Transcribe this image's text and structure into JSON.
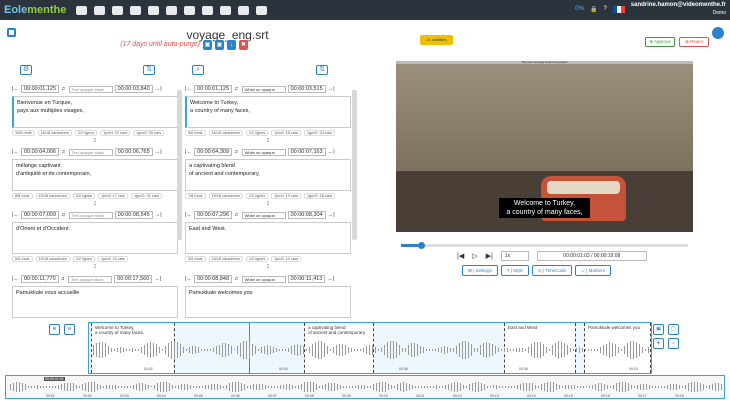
{
  "app": {
    "logo_a": "Eole",
    "logo_b": "menthe",
    "credits": "0%",
    "user_email": "sandrine.hamon@videomenthe.fr",
    "user_role": "Demo"
  },
  "file": {
    "title": "voyage_eng.srt",
    "autopurge": "(17 days until auto-purge)",
    "badge": "21 subtitles"
  },
  "actions": {
    "approve": "⊕ Approve",
    "reject": "⊗ Reject"
  },
  "source": {
    "placeholder_style": "Text opaque black",
    "subs": [
      {
        "start": "00:00:01,125",
        "end": "00:00:03,840",
        "text": "Bienvenue en Turquie,\npays aux multiples visages,",
        "stats": [
          "10/6 mots",
          "16/18 caracteres",
          "2/2 lignes",
          "1pm/l: 22 cars",
          "1gm/2: 25 cars"
        ]
      },
      {
        "start": "00:00:04,006",
        "end": "00:00:06,765",
        "text": "mélange captivant\nd'antiquité et de contemporain,",
        "stats": [
          "8/8 mots",
          "15/18 caracteres",
          "2/2 lignes",
          "1pm/l: 17 cars",
          "1gm/2: 31 cars"
        ]
      },
      {
        "start": "00:00:07,009",
        "end": "00:00:08,545",
        "text": "d'Orient et d'Occident.",
        "stats": [
          "5/6 mots",
          "16/18 caracteres",
          "1/2 lignes",
          "1pm/l: 23 cars"
        ]
      },
      {
        "start": "00:00:11,770",
        "end": "00:00:17,560",
        "text": "Pamukkale vous accueille",
        "stats": []
      }
    ]
  },
  "target": {
    "style": "White on opaque bla...",
    "subs": [
      {
        "start": "00:00:01,125",
        "end": "00:00:03,515",
        "text": "Welcome to Turkey,\na country of many faces,",
        "stats": [
          "8/6 mots",
          "16/18 caracteres",
          "2/2 lignes",
          "1pm/l: 18 cars",
          "1gm/2: 24 cars"
        ]
      },
      {
        "start": "00:00:04,309",
        "end": "00:00:07,163",
        "text": "a captivating blend\nof ancient and contemporary,",
        "stats": [
          "7/8 mots",
          "15/18 caracteres",
          "2/2 lignes",
          "1pm/l: 19 cars",
          "1gm/2: 28 cars"
        ]
      },
      {
        "start": "00:00:07,296",
        "end": "00:00:08,304",
        "text": "East and West.",
        "stats": [
          "3/8 mots",
          "16/18 caracteres",
          "1/2 lignes",
          "1pm/l: 14 cars"
        ]
      },
      {
        "start": "00:00:08,848",
        "end": "00:00:11,413",
        "text": "Pamukkale welcomes you",
        "stats": []
      }
    ]
  },
  "player": {
    "video_banner": "The user viewing 4 bar the position",
    "caption_l1": "Welcome to Turkey,",
    "caption_l2": "a country of many faces,",
    "speed": "1x",
    "time": "00:00:01:03  /  00:00:19:08",
    "progress": 0.07
  },
  "tabs": [
    "⊞ | Settings",
    "T | Style",
    "⊙ | TimeCode",
    "⊥ | Markers"
  ],
  "waveform": {
    "regions": [
      {
        "l1": "Welcome to Turkey,",
        "l2": "a country of many faces,"
      },
      {
        "l1": "a captivating blend",
        "l2": "of ancient and contemporary"
      },
      {
        "l1": "East and West",
        "l2": ""
      },
      {
        "l1": "Pamukkale welcomes you",
        "l2": ""
      }
    ],
    "cursor_label": "00:00:01:03",
    "ticks1": [
      "00:02",
      "00:04",
      "00:06",
      "00:08",
      "00:10"
    ],
    "ticks2": [
      "00:01",
      "00:02",
      "00:03",
      "00:04",
      "00:05",
      "00:06",
      "00:07",
      "00:08",
      "00:09",
      "00:10",
      "00:11",
      "00:12",
      "00:13",
      "00:14",
      "00:15",
      "00:16",
      "00:17",
      "00:18"
    ]
  }
}
